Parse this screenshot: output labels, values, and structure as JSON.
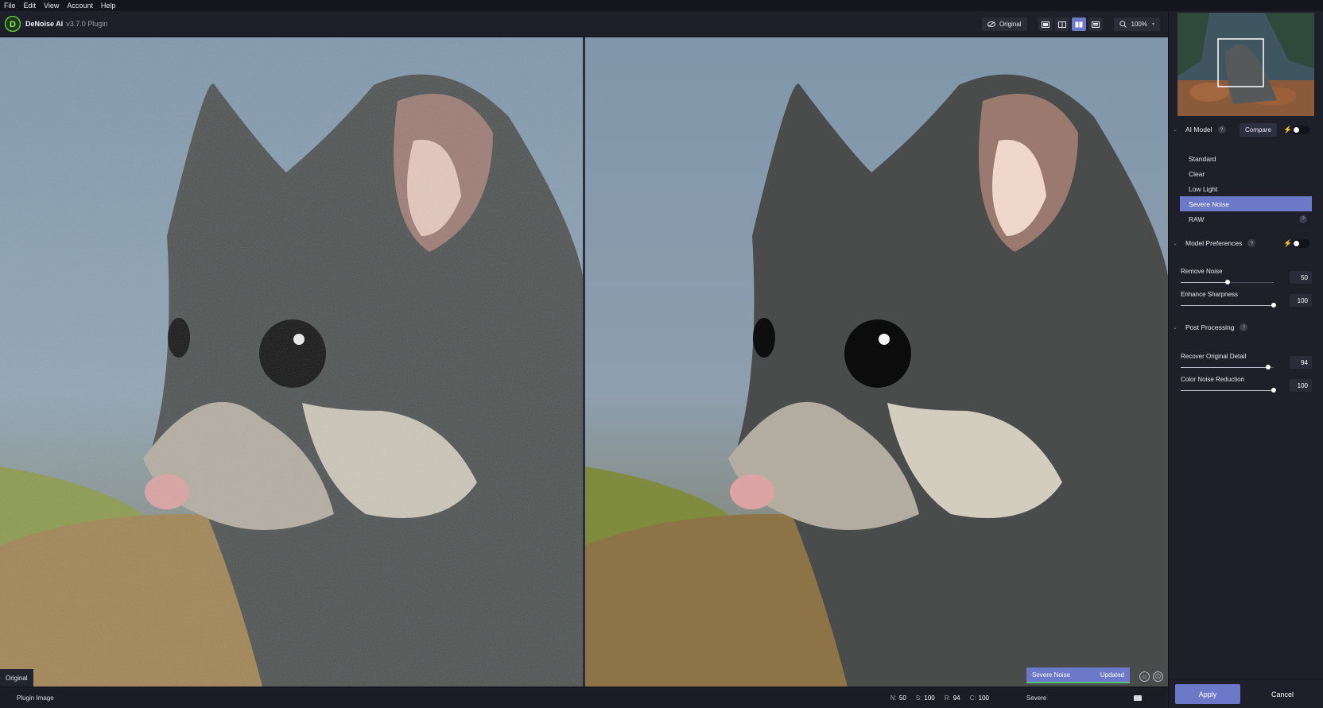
{
  "menu": [
    "File",
    "Edit",
    "View",
    "Account",
    "Help"
  ],
  "app": {
    "name": "DeNoise AI",
    "version": "v3.7.0 Plugin"
  },
  "toolbar": {
    "original_label": "Original",
    "zoom_label": "100%",
    "active_view": "side-by-side"
  },
  "viewer": {
    "left_tag": "Original",
    "status_model": "Severe Noise",
    "status_state": "Updated"
  },
  "statusbar": {
    "source": "Plugin Image",
    "stats": [
      {
        "key": "N:",
        "value": "50"
      },
      {
        "key": "S:",
        "value": "100"
      },
      {
        "key": "R:",
        "value": "94"
      },
      {
        "key": "C:",
        "value": "100"
      }
    ],
    "model": "Severe"
  },
  "sidebar": {
    "ai_model": {
      "title": "AI Model",
      "compare_label": "Compare",
      "items": [
        "Standard",
        "Clear",
        "Low Light",
        "Severe Noise",
        "RAW"
      ],
      "selected": "Severe Noise"
    },
    "model_preferences": {
      "title": "Model Preferences",
      "sliders": [
        {
          "label": "Remove Noise",
          "value": "50",
          "fraction": 0.5
        },
        {
          "label": "Enhance Sharpness",
          "value": "100",
          "fraction": 1.0
        }
      ]
    },
    "post_processing": {
      "title": "Post Processing",
      "sliders": [
        {
          "label": "Recover Original Detail",
          "value": "94",
          "fraction": 0.94
        },
        {
          "label": "Color Noise Reduction",
          "value": "100",
          "fraction": 1.0
        }
      ]
    },
    "apply_label": "Apply",
    "cancel_label": "Cancel"
  },
  "colors": {
    "accent": "#6c79c8",
    "success": "#54c07a",
    "panel": "#1e2029"
  }
}
